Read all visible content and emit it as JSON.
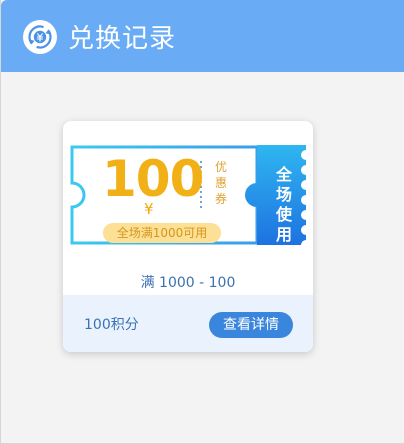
{
  "header": {
    "title": "兑换记录",
    "icon": "exchange-icon"
  },
  "coupon_card": {
    "currency_symbol": "¥",
    "amount": "100",
    "type_label": "优惠券",
    "condition_tag": "全场满1000可用",
    "usage_scope": "全场使用",
    "rule_text": "满 1000 - 100",
    "points_cost": "100积分",
    "detail_button": "查看详情"
  },
  "colors": {
    "header_bg": "#6aabf5",
    "coupon_gold": "#f0b016",
    "coupon_blue": "#1f8bea",
    "button_blue": "#3a86dc",
    "text_blue": "#3b72b2"
  }
}
